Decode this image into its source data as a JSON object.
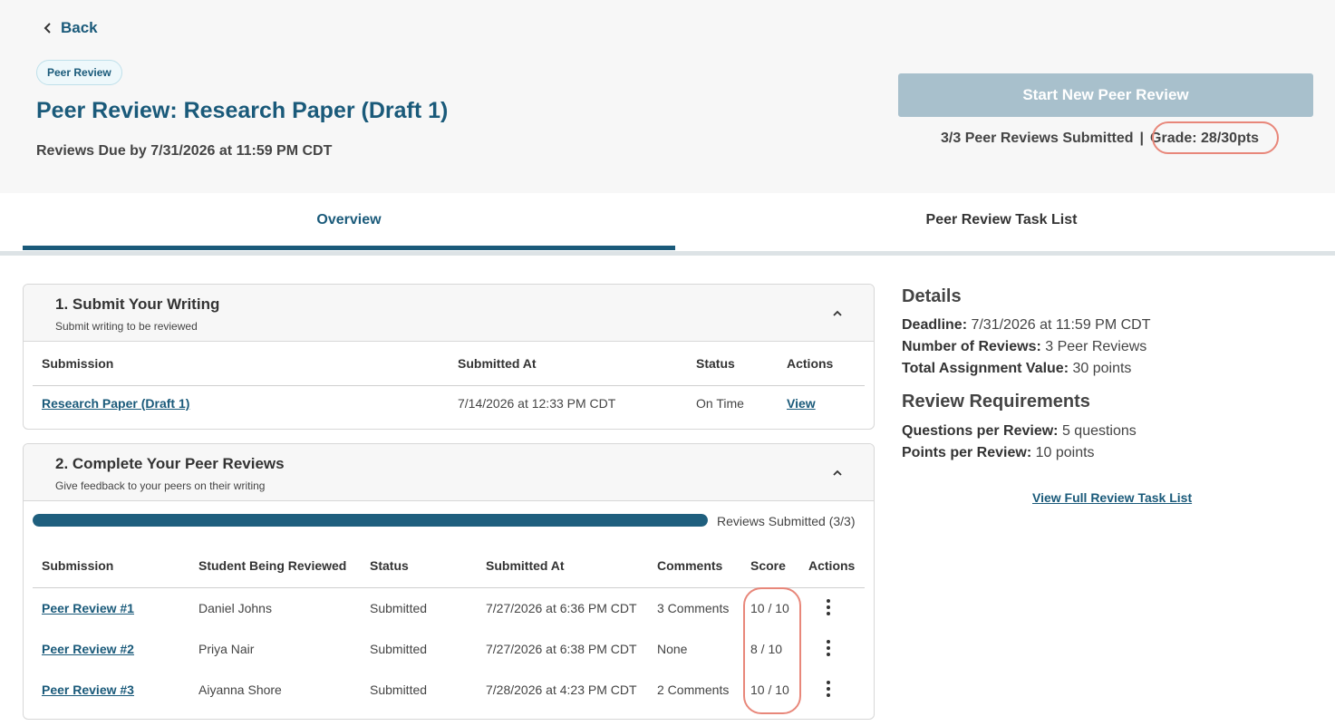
{
  "nav": {
    "back_label": "Back"
  },
  "header": {
    "badge": "Peer Review",
    "title": "Peer Review: Research Paper (Draft 1)",
    "due": "Reviews Due by 7/31/2026 at 11:59 PM CDT",
    "start_button": "Start New Peer Review",
    "submitted_summary": "3/3 Peer Reviews Submitted",
    "separator": "|",
    "grade": "Grade: 28/30pts"
  },
  "tabs": [
    {
      "label": "Overview",
      "active": true
    },
    {
      "label": "Peer Review Task List",
      "active": false
    }
  ],
  "section1": {
    "title": "1. Submit Your Writing",
    "subtitle": "Submit writing to be reviewed",
    "columns": [
      "Submission",
      "Submitted At",
      "Status",
      "Actions"
    ],
    "rows": [
      {
        "submission": "Research Paper (Draft 1)",
        "submitted_at": "7/14/2026 at 12:33 PM CDT",
        "status": "On Time",
        "action": "View"
      }
    ]
  },
  "section2": {
    "title": "2. Complete Your Peer Reviews",
    "subtitle": "Give feedback to your peers on their writing",
    "progress_label": "Reviews Submitted (3/3)",
    "progress_fraction": 1.0,
    "columns": [
      "Submission",
      "Student Being Reviewed",
      "Status",
      "Submitted At",
      "Comments",
      "Score",
      "Actions"
    ],
    "rows": [
      {
        "submission": "Peer Review #1",
        "student": "Daniel Johns",
        "status": "Submitted",
        "submitted_at": "7/27/2026 at 6:36 PM CDT",
        "comments": "3 Comments",
        "score": "10 / 10"
      },
      {
        "submission": "Peer Review #2",
        "student": "Priya Nair",
        "status": "Submitted",
        "submitted_at": "7/27/2026 at 6:38 PM CDT",
        "comments": "None",
        "score": "8 / 10"
      },
      {
        "submission": "Peer Review #3",
        "student": "Aiyanna Shore",
        "status": "Submitted",
        "submitted_at": "7/28/2026 at 4:23 PM CDT",
        "comments": "2 Comments",
        "score": "10 / 10"
      }
    ]
  },
  "details": {
    "heading": "Details",
    "deadline_label": "Deadline:",
    "deadline_value": " 7/31/2026 at 11:59 PM CDT",
    "reviews_label": "Number of Reviews:",
    "reviews_value": " 3 Peer Reviews",
    "value_label": "Total Assignment Value:",
    "value_value": " 30 points",
    "req_heading": "Review Requirements",
    "questions_label": "Questions per Review:",
    "questions_value": " 5 questions",
    "points_label": "Points per Review:",
    "points_value": " 10 points",
    "link": "View Full Review Task List"
  },
  "colors": {
    "brand": "#1a5a7a",
    "highlight": "#e8877a",
    "disabled_button": "#a8c0cc"
  }
}
